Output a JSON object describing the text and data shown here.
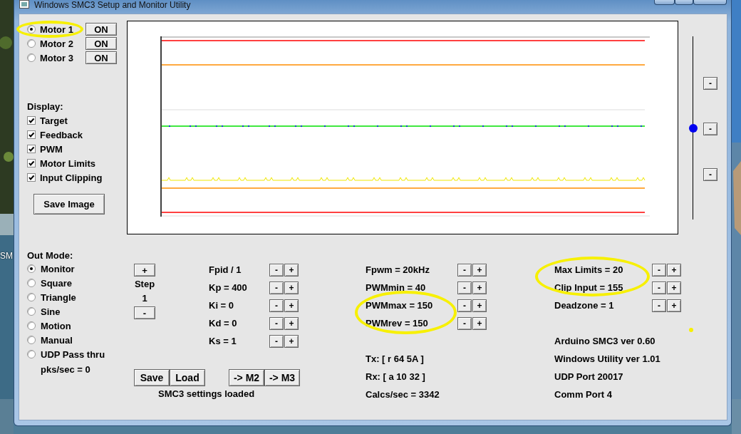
{
  "window": {
    "title": "Windows SMC3 Setup and Monitor Utility"
  },
  "desktop": {
    "icon_label": "SM"
  },
  "motors": [
    {
      "label": "Motor 1",
      "selected": true,
      "button": "ON"
    },
    {
      "label": "Motor 2",
      "selected": false,
      "button": "ON"
    },
    {
      "label": "Motor 3",
      "selected": false,
      "button": "ON"
    }
  ],
  "display": {
    "label": "Display:",
    "options": [
      {
        "label": "Target",
        "checked": true
      },
      {
        "label": "Feedback",
        "checked": true
      },
      {
        "label": "PWM",
        "checked": true
      },
      {
        "label": "Motor Limits",
        "checked": true
      },
      {
        "label": "Input Clipping",
        "checked": true
      }
    ]
  },
  "save_image_button": "Save Image",
  "position_slider": {
    "level": 0.5
  },
  "slider_buttons": [
    "-",
    "-",
    "-"
  ],
  "out_mode": {
    "label": "Out Mode:",
    "options": [
      {
        "label": "Monitor",
        "selected": true
      },
      {
        "label": "Square",
        "selected": false
      },
      {
        "label": "Triangle",
        "selected": false
      },
      {
        "label": "Sine",
        "selected": false
      },
      {
        "label": "Motion",
        "selected": false
      },
      {
        "label": "Manual",
        "selected": false
      },
      {
        "label": "UDP Pass thru",
        "selected": false
      }
    ],
    "packets": "pks/sec = 0"
  },
  "step": {
    "increase": "+",
    "label": "Step",
    "value": "1",
    "decrease": "-"
  },
  "pid_params": [
    {
      "label": "Fpid / 1",
      "minus": "-",
      "plus": "+"
    },
    {
      "label": "Kp = 400",
      "minus": "-",
      "plus": "+"
    },
    {
      "label": "Ki = 0",
      "minus": "-",
      "plus": "+"
    },
    {
      "label": "Kd = 0",
      "minus": "-",
      "plus": "+"
    },
    {
      "label": "Ks = 1",
      "minus": "-",
      "plus": "+"
    }
  ],
  "settings_buttons": [
    "Save",
    "Load"
  ],
  "copy_buttons": [
    "-> M2",
    "-> M3"
  ],
  "status": "SMC3 settings loaded",
  "pwm_params": [
    {
      "label": "Fpwm = 20kHz",
      "minus": "-",
      "plus": "+"
    },
    {
      "label": "PWMmin = 40",
      "minus": "-",
      "plus": "+"
    },
    {
      "label": "PWMmax = 150",
      "minus": "-",
      "plus": "+"
    },
    {
      "label": "PWMrev = 150",
      "minus": "-",
      "plus": "+"
    }
  ],
  "comm_stats": [
    "Tx: [ r 64 5A ]",
    "Rx: [ a 10 32 ]",
    "Calcs/sec = 3342"
  ],
  "limit_params": [
    {
      "label": "Max Limits = 20",
      "minus": "-",
      "plus": "+"
    },
    {
      "label": "Clip Input = 155",
      "minus": "-",
      "plus": "+"
    },
    {
      "label": "Deadzone = 1",
      "minus": "-",
      "plus": "+"
    }
  ],
  "versions": [
    "Arduino SMC3 ver 0.60",
    "Windows Utility ver 1.01",
    "UDP Port 20017",
    "Comm Port 4"
  ]
}
